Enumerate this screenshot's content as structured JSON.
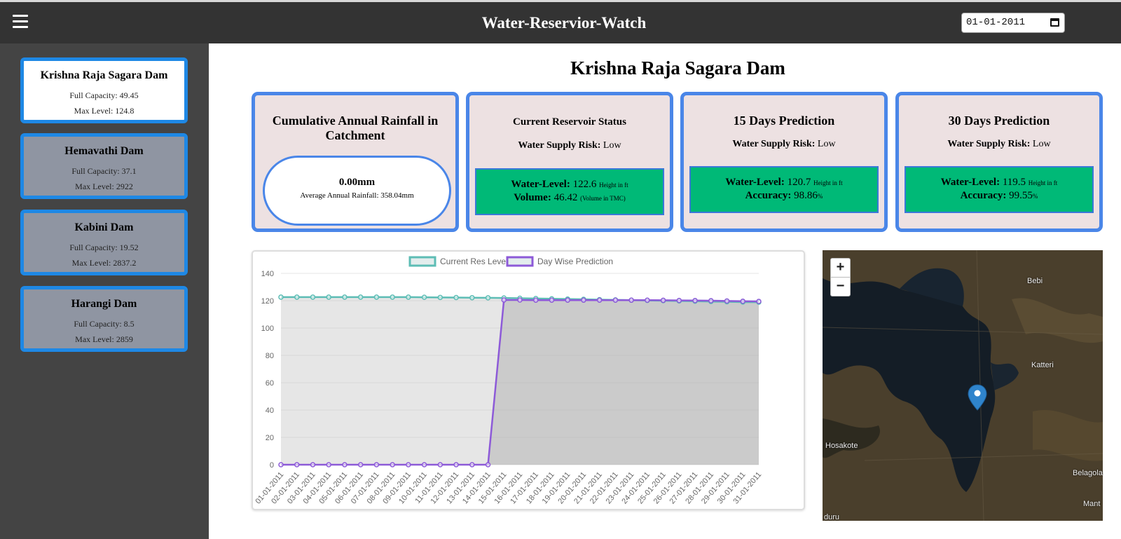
{
  "header": {
    "title": "Water-Reservior-Watch",
    "date_value": "01-01-2011"
  },
  "sidebar": {
    "dams": [
      {
        "name": "Krishna Raja Sagara Dam",
        "capacity": "Full Capacity: 49.45",
        "level": "Max Level: 124.8",
        "active": true
      },
      {
        "name": "Hemavathi Dam",
        "capacity": "Full Capacity: 37.1",
        "level": "Max Level: 2922",
        "active": false
      },
      {
        "name": "Kabini Dam",
        "capacity": "Full Capacity: 19.52",
        "level": "Max Level: 2837.2",
        "active": false
      },
      {
        "name": "Harangi Dam",
        "capacity": "Full Capacity: 8.5",
        "level": "Max Level: 2859",
        "active": false
      }
    ]
  },
  "main": {
    "title": "Krishna Raja Sagara Dam",
    "rainfall": {
      "title": "Cumulative Annual Rainfall in Catchment",
      "value": "0.00mm",
      "average": "Average Annual Rainfall: 358.04mm"
    },
    "current": {
      "title": "Current Reservoir Status",
      "risk_label": "Water Supply Risk:",
      "risk_value": "Low",
      "level_label": "Water-Level:",
      "level_value": "122.6",
      "level_unit": "Height in ft",
      "volume_label": "Volume:",
      "volume_value": "46.42",
      "volume_unit": "(Volume in TMC)"
    },
    "pred15": {
      "title": "15 Days Prediction",
      "risk_label": "Water Supply Risk:",
      "risk_value": "Low",
      "level_label": "Water-Level:",
      "level_value": "120.7",
      "level_unit": "Height in ft",
      "acc_label": "Accuracy:",
      "acc_value": "98.86",
      "acc_unit": "%"
    },
    "pred30": {
      "title": "30 Days Prediction",
      "risk_label": "Water Supply Risk:",
      "risk_value": "Low",
      "level_label": "Water-Level:",
      "level_value": "119.5",
      "level_unit": "Height in ft",
      "acc_label": "Accuracy:",
      "acc_value": "99.55",
      "acc_unit": "%"
    }
  },
  "map": {
    "zoom_in": "+",
    "zoom_out": "−",
    "labels": [
      "Bebi",
      "Katteri",
      "Hosakote",
      "Belagola",
      "Mant",
      "duru"
    ]
  },
  "colors": {
    "header": "#333333",
    "sidebar": "#444444",
    "card_border": "#4a86e8",
    "green": "#00b977",
    "series_current": "#5dbdb5",
    "series_prediction": "#8d5ad8"
  },
  "chart_data": {
    "type": "line",
    "categories": [
      "01-01-2011",
      "02-01-2011",
      "03-01-2011",
      "04-01-2011",
      "05-01-2011",
      "06-01-2011",
      "07-01-2011",
      "08-01-2011",
      "09-01-2011",
      "10-01-2011",
      "11-01-2011",
      "12-01-2011",
      "13-01-2011",
      "14-01-2011",
      "15-01-2011",
      "16-01-2011",
      "17-01-2011",
      "18-01-2011",
      "19-01-2011",
      "20-01-2011",
      "21-01-2011",
      "22-01-2011",
      "23-01-2011",
      "24-01-2011",
      "25-01-2011",
      "26-01-2011",
      "27-01-2011",
      "28-01-2011",
      "29-01-2011",
      "30-01-2011",
      "31-01-2011"
    ],
    "series": [
      {
        "name": "Current Res Level",
        "values": [
          122.6,
          122.6,
          122.6,
          122.6,
          122.6,
          122.6,
          122.6,
          122.6,
          122.6,
          122.5,
          122.4,
          122.3,
          122.2,
          122.1,
          122.0,
          121.8,
          121.6,
          121.4,
          121.2,
          121.0,
          120.8,
          120.6,
          120.4,
          120.2,
          120.0,
          119.8,
          119.6,
          119.4,
          119.2,
          119.0,
          118.9
        ]
      },
      {
        "name": "Day Wise Prediction",
        "values": [
          0,
          0,
          0,
          0,
          0,
          0,
          0,
          0,
          0,
          0,
          0,
          0,
          0,
          0,
          120.5,
          120.5,
          120.4,
          120.4,
          120.4,
          120.4,
          120.4,
          120.4,
          120.4,
          120.4,
          120.3,
          120.2,
          120.1,
          120.0,
          119.8,
          119.6,
          119.5
        ]
      }
    ],
    "yticks": [
      0,
      20,
      40,
      60,
      80,
      100,
      120,
      140
    ],
    "ylim": [
      0,
      140
    ],
    "grid": true,
    "legend": "top-center"
  }
}
